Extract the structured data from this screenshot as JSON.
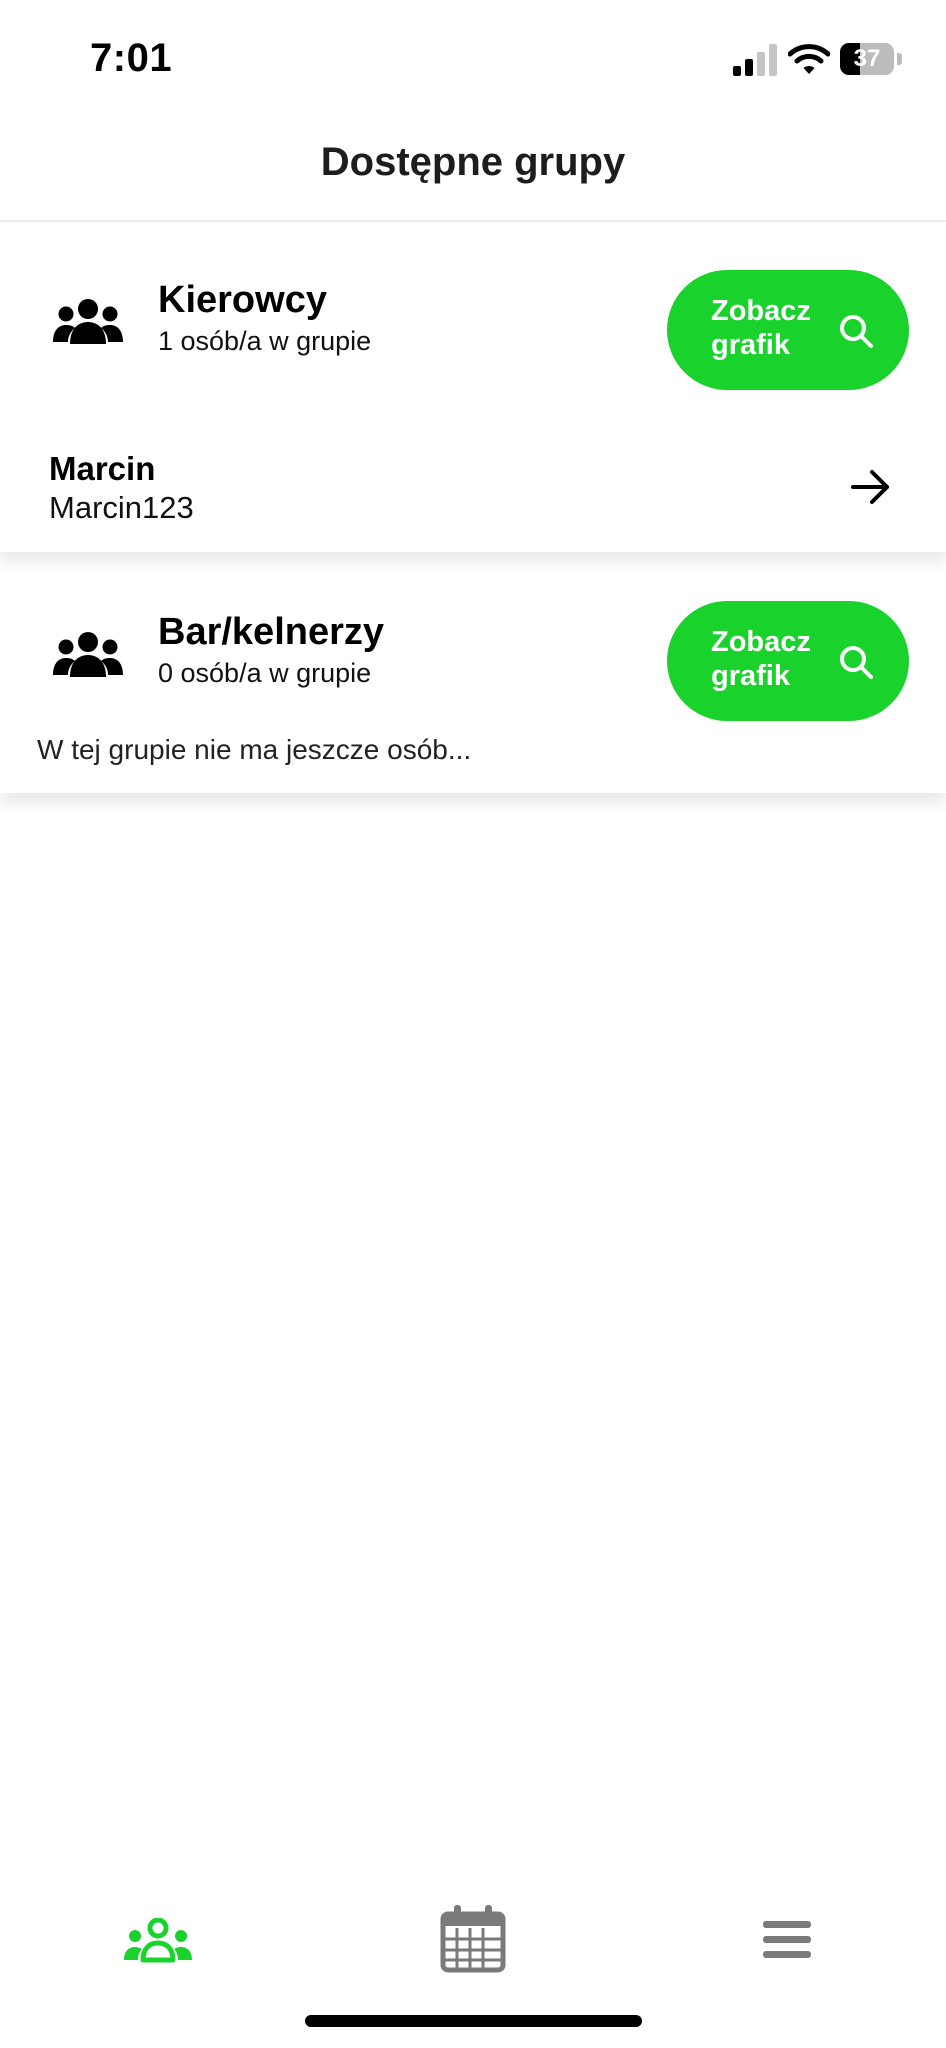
{
  "status_bar": {
    "time": "7:01",
    "battery_level": "37",
    "battery_fraction": 0.37,
    "icons": [
      "signal-icon",
      "wifi-icon",
      "battery-icon"
    ]
  },
  "header": {
    "title": "Dostępne grupy"
  },
  "groups": [
    {
      "name": "Kierowcy",
      "count_label": "1 osób/a w grupie",
      "button_label": "Zobacz grafik",
      "icon": "group-icon",
      "members": [
        {
          "name": "Marcin",
          "username": "Marcin123",
          "icon": "arrow-right-icon"
        }
      ]
    },
    {
      "name": "Bar/kelnerzy",
      "count_label": "0 osób/a w grupie",
      "button_label": "Zobacz grafik",
      "icon": "group-icon",
      "empty_message": "W tej grupie nie ma jeszcze osób..."
    }
  ],
  "tab_bar": {
    "tabs": [
      {
        "icon": "groups-icon",
        "active": true
      },
      {
        "icon": "calendar-icon",
        "active": false
      },
      {
        "icon": "menu-icon",
        "active": false
      }
    ]
  },
  "colors": {
    "accent": "#19d22c",
    "tab_inactive": "#7a7a7a",
    "text": "#000000"
  }
}
